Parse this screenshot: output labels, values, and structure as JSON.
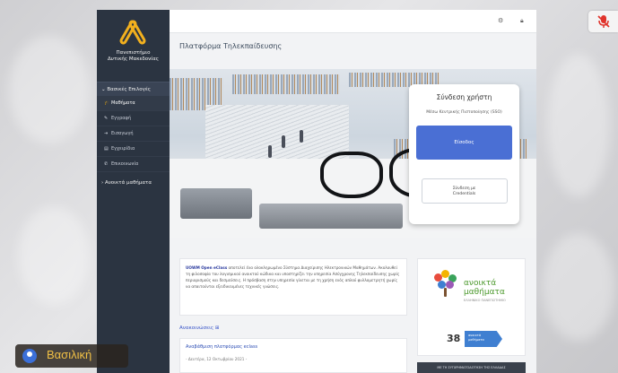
{
  "app": {
    "brand_name_line1": "Πανεπιστήμιο",
    "brand_name_line2": "Δυτικής Μακεδονίας",
    "page_title": "Πλατφόρμα Τηλεκπαίδευσης"
  },
  "sidebar": {
    "section_head": "Βασικές Επιλογές",
    "items": [
      {
        "label": "Μαθήματα",
        "icon": "graduation-icon"
      },
      {
        "label": "Εγγραφή",
        "icon": "edit-icon"
      },
      {
        "label": "Εισαγωγή",
        "icon": "login-icon"
      },
      {
        "label": "Εγχειρίδια",
        "icon": "book-icon"
      },
      {
        "label": "Επικοινωνία",
        "icon": "phone-icon"
      }
    ],
    "footer_head": "Ανοικτά μαθήματα"
  },
  "login": {
    "title": "Σύνδεση χρήστη",
    "subtitle": "Μέσω Κεντρικής Πιστοποίησης (SSO)",
    "primary_button": "Είσοδος",
    "secondary_line1": "Σύνδεση με",
    "secondary_line2": "Credentials"
  },
  "description": {
    "brand": "UOWM Open eClass",
    "text": " αποτελεί ένα ολοκληρωμένο Σύστημα Διαχείρισης Ηλεκτρονικών Μαθημάτων. Ακολουθεί τη φιλοσοφία του λογισμικού ανοικτού κώδικα και υποστηρίζει την υπηρεσία Ασύγχρονης Τηλεκπαίδευσης χωρίς περιορισμούς και δεσμεύσεις. Η πρόσβαση στην υπηρεσία γίνεται με τη χρήση ενός απλού φυλλομετρητή χωρίς να απαιτούνται εξειδικευμένες τεχνικές γνώσεις."
  },
  "announcements": {
    "head": "Ανακοινώσεις",
    "item_title": "Αναβάθμιση πλατφόρμας eclass",
    "item_date": "- Δευτέρα, 12 Οκτωβρίου 2021 -"
  },
  "open_courses": {
    "title_line1": "ανοικτά",
    "title_line2": "μαθήματα",
    "small": "ΕΛΛΗΝΙΚΟ ΠΑΝΕΠΙΣΤΗΜΙΟ",
    "count": "38",
    "arrow_line1": "ανοικτά",
    "arrow_line2": "μαθήματα",
    "strip": "ΜΕ ΤΗ ΣΥΓΧΡΗΜΑΤΟΔΟΤΗΣΗ ΤΗΣ ΕΛΛΑΔΑΣ"
  },
  "participant": {
    "name": "Βασιλική"
  },
  "colors": {
    "sidebar": "#2b3441",
    "primary_button": "#4a6fd4",
    "accent_text": "#3a56c9",
    "name_text": "#f1c045",
    "mute_icon": "#e0342c"
  }
}
